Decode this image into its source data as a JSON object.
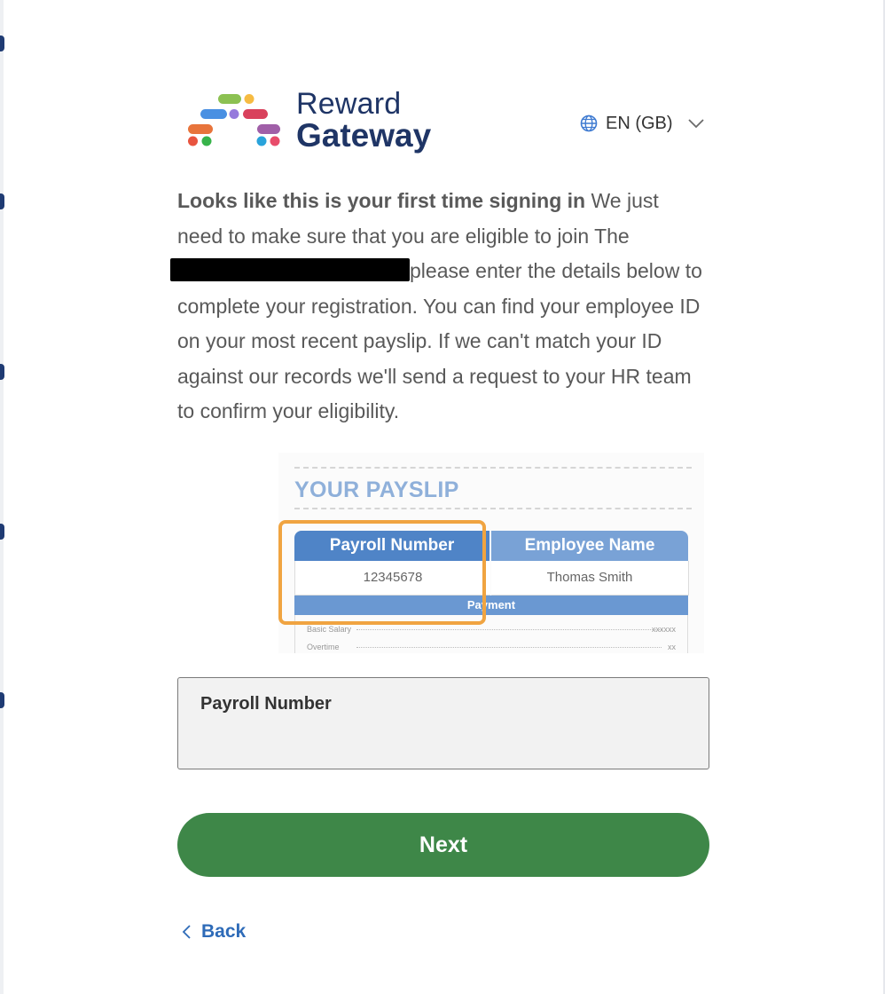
{
  "brand": {
    "logo_line1": "Reward",
    "logo_line2": "Gateway",
    "colors": {
      "navy": "#1f3566",
      "green_button": "#3e8748",
      "link_blue": "#2e6bb8",
      "highlight_orange": "#f0a441"
    }
  },
  "language": {
    "icon": "globe-icon",
    "label": "EN (GB)",
    "dropdown_icon": "chevron-down-icon"
  },
  "intro": {
    "bold": "Looks like this is your first time signing in",
    "part1": " We just need to make sure that you are eligible to join The ",
    "part2": "please enter the details below to complete your registration. You can find your employee ID on your most recent payslip. If we can't match your ID against our records we'll send a request to your HR team to confirm your eligibility."
  },
  "payslip_example": {
    "title": "YOUR PAYSLIP",
    "col1_header": "Payroll Number",
    "col2_header": "Employee Name",
    "col1_value": "12345678",
    "col2_value": "Thomas Smith",
    "band_label": "Payment",
    "rows": [
      {
        "label": "Basic Salary",
        "value": "xxxxxx"
      },
      {
        "label": "Overtime",
        "value": "xx"
      }
    ]
  },
  "form": {
    "field_label": "Payroll Number",
    "field_value": "",
    "field_placeholder": ""
  },
  "actions": {
    "next_label": "Next",
    "back_label": "Back",
    "back_icon": "chevron-left-icon"
  }
}
